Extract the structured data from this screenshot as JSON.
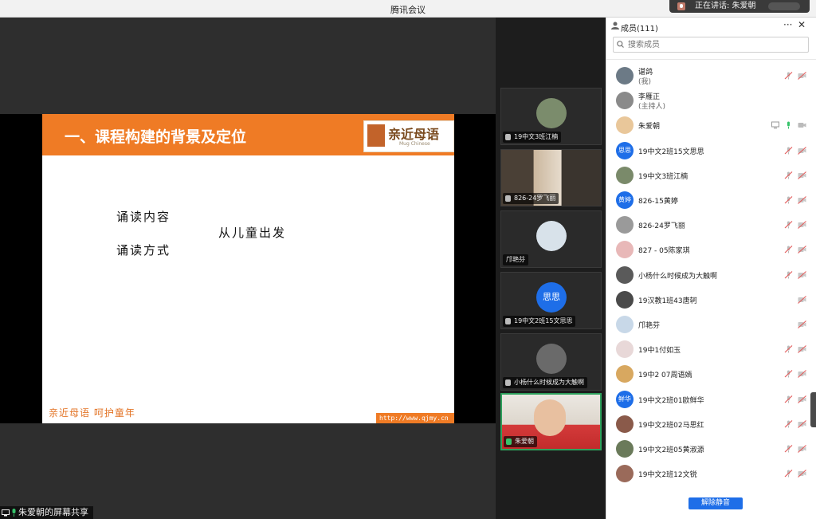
{
  "window": {
    "title": "腾讯会议"
  },
  "speaking": {
    "label": "正在讲话: 朱爱朝"
  },
  "slide": {
    "title": "一、课程构建的背景及定位",
    "logo_text": "亲近母语",
    "logo_sub": "Mug Chinese",
    "line1": "诵读内容",
    "line2": "诵读方式",
    "line3": "从儿童出发",
    "footer_left": "亲近母语 呵护童年",
    "footer_right": "http://www.qjmy.cn"
  },
  "share_status": "朱爱朝的屏幕共享",
  "tiles": [
    {
      "name": "19中文3班江楠",
      "mic": "muted"
    },
    {
      "name": "826-24罗飞丽",
      "mic": "muted"
    },
    {
      "name": "邝艳芬",
      "mic": "none"
    },
    {
      "name": "19中文2班15文思思",
      "mic": "muted",
      "avatar_text": "思思"
    },
    {
      "name": "小杨什么时候成为大触啊",
      "mic": "muted"
    },
    {
      "name": "朱爱朝",
      "mic": "active"
    }
  ],
  "panel": {
    "title": "成员(111)",
    "more": "···",
    "close": "✕",
    "search_placeholder": "搜索成员",
    "unmute_label": "解除静音",
    "accent": "#1e6ee8"
  },
  "members": [
    {
      "name": "谌鸽",
      "role": "(我)",
      "avatar": "photo",
      "color": "#6c7a86",
      "mic": "muted",
      "cam": "off"
    },
    {
      "name": "李雁正",
      "role": "(主持人)",
      "avatar": "photo",
      "color": "#8a8a8a",
      "mic": "none",
      "cam": "none"
    },
    {
      "name": "朱爱朝",
      "role": "",
      "avatar": "photo",
      "color": "#e9c79a",
      "mic": "active",
      "cam": "on",
      "screen": true
    },
    {
      "name": "19中文2班15文思思",
      "role": "",
      "avatar": "text",
      "avatar_text": "思思",
      "color": "#1e6ee8",
      "mic": "muted",
      "cam": "off"
    },
    {
      "name": "19中文3班江楠",
      "role": "",
      "avatar": "photo",
      "color": "#7a8a6a",
      "mic": "muted",
      "cam": "off"
    },
    {
      "name": "826-15黄婷",
      "role": "",
      "avatar": "text",
      "avatar_text": "黄婷",
      "color": "#1e6ee8",
      "mic": "muted",
      "cam": "off"
    },
    {
      "name": "826-24罗飞丽",
      "role": "",
      "avatar": "photo",
      "color": "#9a9a9a",
      "mic": "muted",
      "cam": "off"
    },
    {
      "name": "827 - 05陈家琪",
      "role": "",
      "avatar": "photo",
      "color": "#e8b8b8",
      "mic": "muted",
      "cam": "off"
    },
    {
      "name": "小杨什么时候成为大触啊",
      "role": "",
      "avatar": "photo",
      "color": "#5a5a5a",
      "mic": "muted",
      "cam": "off"
    },
    {
      "name": "19汉教1班43唐轲",
      "role": "",
      "avatar": "photo",
      "color": "#4a4a4a",
      "mic": "none",
      "cam": "off"
    },
    {
      "name": "邝艳芬",
      "role": "",
      "avatar": "photo",
      "color": "#c8d8e8",
      "mic": "none",
      "cam": "off"
    },
    {
      "name": "19中1付如玉",
      "role": "",
      "avatar": "photo",
      "color": "#e8d8d8",
      "mic": "muted",
      "cam": "off"
    },
    {
      "name": "19中2 07周语嫣",
      "role": "",
      "avatar": "photo",
      "color": "#d8a860",
      "mic": "muted",
      "cam": "off"
    },
    {
      "name": "19中文2班01欧鲜华",
      "role": "",
      "avatar": "text",
      "avatar_text": "鲜华",
      "color": "#1e6ee8",
      "mic": "muted",
      "cam": "off"
    },
    {
      "name": "19中文2班02马思红",
      "role": "",
      "avatar": "photo",
      "color": "#8a5a4a",
      "mic": "muted",
      "cam": "off"
    },
    {
      "name": "19中文2班05黄淑源",
      "role": "",
      "avatar": "photo",
      "color": "#6a7a5a",
      "mic": "muted",
      "cam": "off"
    },
    {
      "name": "19中文2班12文锐",
      "role": "",
      "avatar": "photo",
      "color": "#9a6a5a",
      "mic": "muted",
      "cam": "off"
    }
  ]
}
